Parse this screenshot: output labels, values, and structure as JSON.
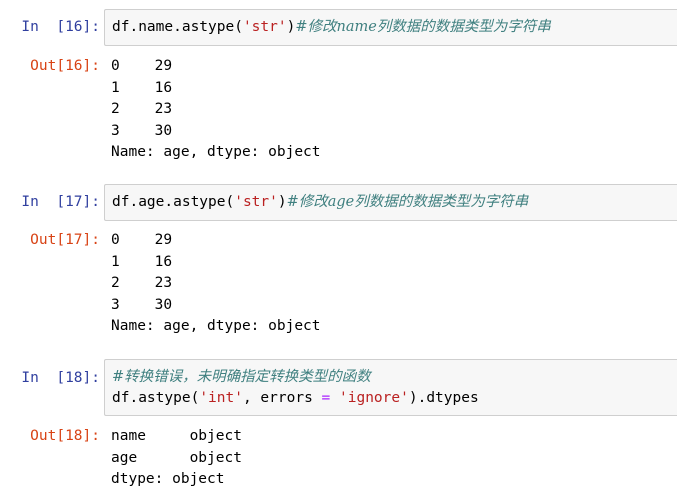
{
  "cells": [
    {
      "in_prompt": "In  [16]:",
      "code": {
        "prefix": "df.name.astype(",
        "string": "'str'",
        "suffix": ")",
        "comment": "#修改name列数据的数据类型为字符串"
      },
      "out_prompt": "Out[16]:",
      "output": [
        "0    29",
        "1    16",
        "2    23",
        "3    30",
        "Name: age, dtype: object"
      ]
    },
    {
      "in_prompt": "In  [17]:",
      "code": {
        "prefix": "df.age.astype(",
        "string": "'str'",
        "suffix": ")",
        "comment": "#修改age列数据的数据类型为字符串"
      },
      "out_prompt": "Out[17]:",
      "output": [
        "0    29",
        "1    16",
        "2    23",
        "3    30",
        "Name: age, dtype: object"
      ]
    },
    {
      "in_prompt": "In  [18]:",
      "code": {
        "comment_line": "#转换错误，未明确指定转换类型的函数",
        "p1": "df.astype(",
        "s1": "'int'",
        "p2": ", errors ",
        "eq": "=",
        "p3": " ",
        "s2": "'ignore'",
        "p4": ").dtypes"
      },
      "out_prompt": "Out[18]:",
      "output": [
        "name     object",
        "age      object",
        "dtype: object"
      ]
    }
  ]
}
